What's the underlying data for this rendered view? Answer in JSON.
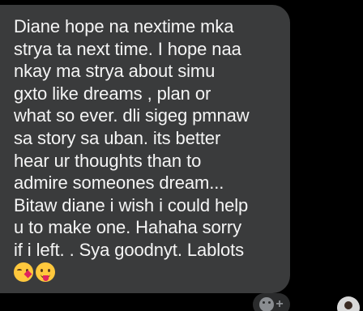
{
  "message": {
    "lines": [
      "Diane hope na nextime mka",
      "strya ta next time. I hope naa",
      "nkay ma strya about simu",
      "gxto like dreams , plan or",
      "what so ever. dli sigeg pmnaw",
      "sa story sa uban. its better",
      "hear ur thoughts than to",
      "admire someones dream...",
      "Bitaw diane i wish i could help",
      "u to make one. Hahaha sorry",
      "if i left. . Sya goodnyt. Lablots"
    ],
    "emojis": [
      "face-blowing-kiss-icon",
      "face-with-tongue-icon"
    ]
  },
  "reaction": {
    "icon": "add-reaction-icon",
    "plus": "+"
  },
  "colors": {
    "background": "#000000",
    "bubble": "#3a3b3c",
    "text": "#f5f5f5"
  }
}
